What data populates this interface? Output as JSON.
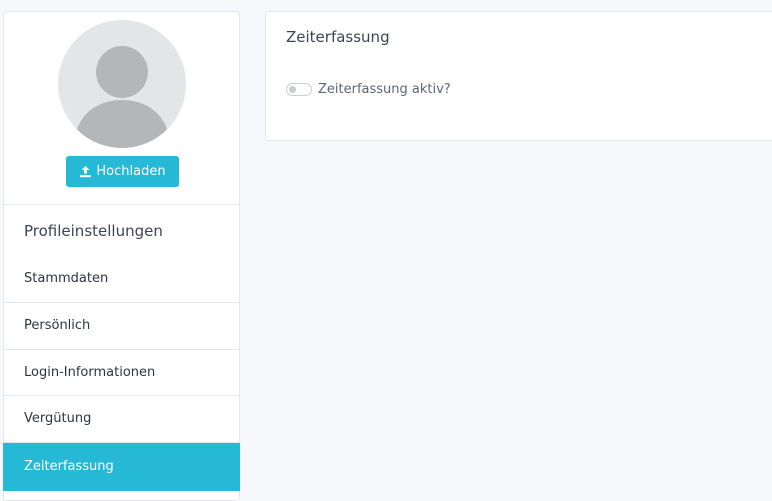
{
  "sidebar": {
    "upload_label": "Hochladen",
    "section_title": "Profileinstellungen",
    "items": [
      {
        "label": "Stammdaten",
        "active": false
      },
      {
        "label": "Persönlich",
        "active": false
      },
      {
        "label": "Login-Informationen",
        "active": false
      },
      {
        "label": "Vergütung",
        "active": false
      },
      {
        "label": "Zeiterfassung",
        "active": true
      }
    ]
  },
  "main": {
    "card_title": "Zeiterfassung",
    "toggle": {
      "label": "Zeiterfassung aktiv?",
      "checked": false
    }
  },
  "colors": {
    "accent": "#25b9d6",
    "background": "#f7f8fb",
    "card": "#ffffff"
  },
  "icons": {
    "avatar": "user-silhouette-icon",
    "upload": "upload-icon"
  }
}
